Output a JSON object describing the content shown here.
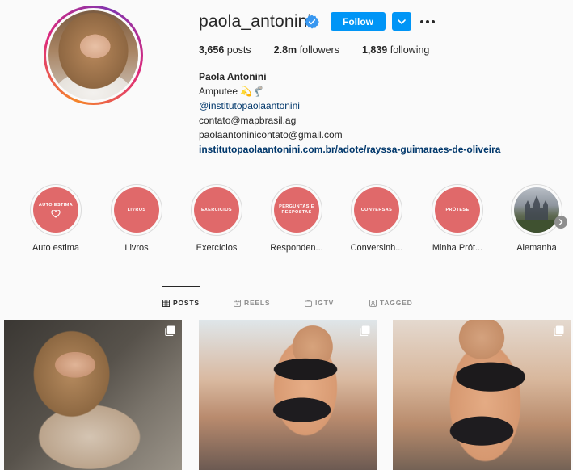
{
  "profile": {
    "username": "paola_antonini",
    "follow_label": "Follow",
    "stats": {
      "posts": "3,656",
      "posts_label": "posts",
      "followers": "2.8m",
      "followers_label": "followers",
      "following": "1,839",
      "following_label": "following"
    },
    "bio": {
      "name": "Paola Antonini",
      "line1": "Amputee 💫🦿",
      "mention": "@institutopaolaantonini",
      "line3": "contato@mapbrasil.ag",
      "line4": "paolaantoninicontato@gmail.com",
      "link": "institutopaolaantonini.com.br/adote/rayssa-guimaraes-de-oliveira"
    }
  },
  "highlights": [
    {
      "cover_text": "AUTO ESTIMA",
      "label": "Auto estima",
      "cover_icon": "heart-icon"
    },
    {
      "cover_text": "LIVROS",
      "label": "Livros"
    },
    {
      "cover_text": "EXERCICIOS",
      "label": "Exercícios"
    },
    {
      "cover_text": "PERGUNTAS E RESPOSTAS",
      "label": "Responden..."
    },
    {
      "cover_text": "CONVERSAS",
      "label": "Conversinh..."
    },
    {
      "cover_text": "PRÓTESE",
      "label": "Minha Prót..."
    },
    {
      "cover_text": "",
      "label": "Alemanha",
      "cover_icon": "photo"
    }
  ],
  "tabs": [
    {
      "label": "POSTS",
      "icon": "grid-icon",
      "active": true
    },
    {
      "label": "REELS",
      "icon": "reels-icon",
      "active": false
    },
    {
      "label": "IGTV",
      "icon": "igtv-icon",
      "active": false
    },
    {
      "label": "TAGGED",
      "icon": "tagged-icon",
      "active": false
    }
  ],
  "colors": {
    "follow_blue": "#0095f6",
    "highlight_coral": "#e0696a",
    "link_navy": "#00376b",
    "verified_blue": "#3897f0"
  }
}
